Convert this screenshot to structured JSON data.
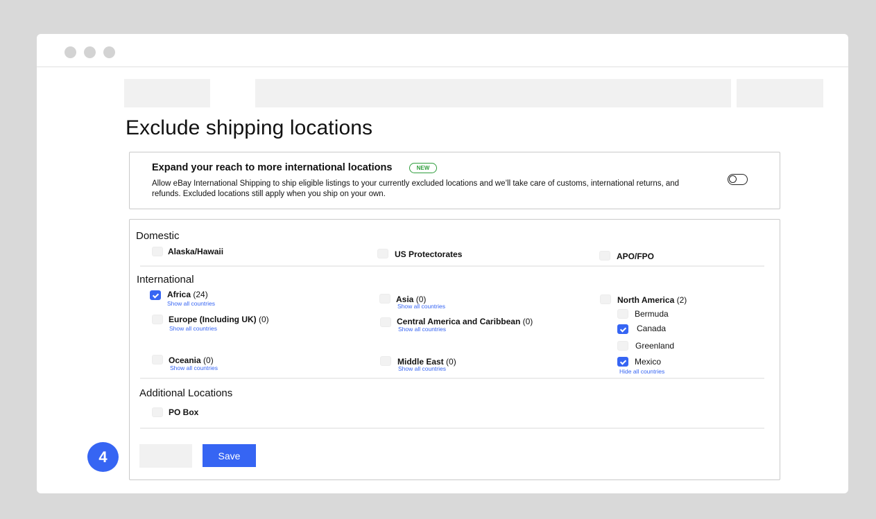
{
  "page": {
    "title": "Exclude shipping locations",
    "step_number": "4"
  },
  "promo": {
    "title": "Expand your reach to more international locations",
    "badge": "NEW",
    "description": "Allow eBay International Shipping to ship eligible listings to your currently excluded locations and we’ll take care of customs, international returns, and refunds. Excluded locations still apply when you ship on your own.",
    "toggle_on": false
  },
  "domestic": {
    "title": "Domestic",
    "items": [
      {
        "name": "Alaska/Hawaii",
        "checked": false
      },
      {
        "name": "US Protectorates",
        "checked": false
      },
      {
        "name": "APO/FPO",
        "checked": false
      }
    ]
  },
  "international": {
    "title": "International",
    "regions": [
      {
        "name": "Africa",
        "count": "(24)",
        "checked": true,
        "link": "Show all countries"
      },
      {
        "name": "Asia",
        "count": "(0)",
        "checked": false,
        "link": "Show all countries"
      },
      {
        "name": "North America",
        "count": "(2)",
        "checked": false,
        "link": "Hide all countries"
      },
      {
        "name": "Europe (Including UK)",
        "count": "(0)",
        "checked": false,
        "link": "Show all countries"
      },
      {
        "name": "Central America and Caribbean",
        "count": "(0)",
        "checked": false,
        "link": "Show all countries"
      },
      {
        "name": "Oceania",
        "count": "(0)",
        "checked": false,
        "link": "Show all countries"
      },
      {
        "name": "Middle East",
        "count": "(0)",
        "checked": false,
        "link": "Show all countries"
      }
    ],
    "north_america_countries": [
      {
        "name": "Bermuda",
        "checked": false
      },
      {
        "name": "Canada",
        "checked": true
      },
      {
        "name": "Greenland",
        "checked": false
      },
      {
        "name": "Mexico",
        "checked": true
      }
    ]
  },
  "additional": {
    "title": "Additional Locations",
    "items": [
      {
        "name": "PO Box",
        "checked": false
      }
    ]
  },
  "actions": {
    "save_label": "Save"
  },
  "colors": {
    "accent": "#3665f3",
    "badge_green": "#2e9d3c",
    "background": "#d9d9d9",
    "placeholder": "#f1f1f1"
  }
}
